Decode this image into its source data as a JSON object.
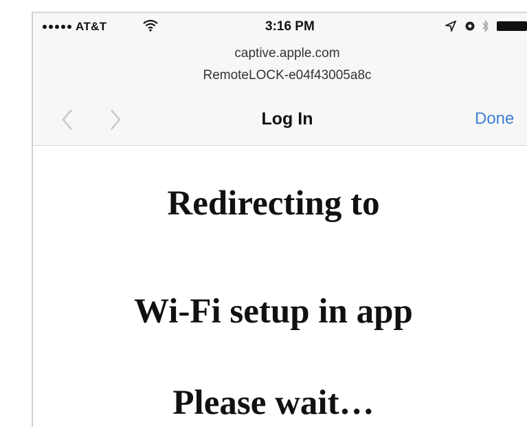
{
  "status_bar": {
    "carrier": "AT&T",
    "time": "3:16 PM",
    "signal_dots": 5,
    "icons": [
      "signal-dots-icon",
      "wifi-icon",
      "location-arrow-icon",
      "alarm-icon",
      "bluetooth-icon",
      "battery-icon"
    ]
  },
  "browser": {
    "domain": "captive.apple.com",
    "network_name": "RemoteLOCK-e04f43005a8c",
    "title": "Log In",
    "done_label": "Done",
    "back_icon": "chevron-left-icon",
    "forward_icon": "chevron-right-icon",
    "link_color": "#3d7fd1"
  },
  "content": {
    "line1": "Redirecting to",
    "line2": "Wi-Fi setup in app",
    "line3": "Please wait…"
  }
}
